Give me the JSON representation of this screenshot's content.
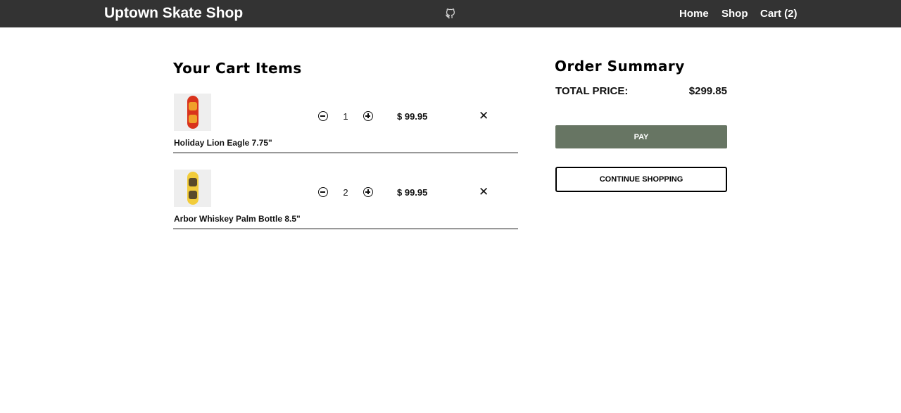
{
  "header": {
    "brand": "Uptown Skate Shop",
    "github_icon": "github-icon",
    "nav": {
      "home": "Home",
      "shop": "Shop",
      "cart": "Cart (2)"
    }
  },
  "cart": {
    "title": "Your Cart Items",
    "items": [
      {
        "name": "Holiday Lion Eagle 7.75\"",
        "quantity": "1",
        "price": "$ 99.95",
        "deck_color": "#d9331c",
        "art_color": "#f0a02a"
      },
      {
        "name": "Arbor Whiskey Palm Bottle 8.5\"",
        "quantity": "2",
        "price": "$ 99.95",
        "deck_color": "#f2cc3a",
        "art_color": "#5a4a2a"
      }
    ],
    "icons": {
      "decrement": "minus-circle-icon",
      "increment": "plus-circle-icon",
      "remove": "close-icon"
    },
    "remove_glyph": "✕"
  },
  "summary": {
    "title": "Order Summary",
    "total_label": "TOTAL PRICE:",
    "total_value": "$299.85",
    "pay_label": "PAY",
    "continue_label": "CONTINUE SHOPPING",
    "pay_color": "#677563"
  }
}
